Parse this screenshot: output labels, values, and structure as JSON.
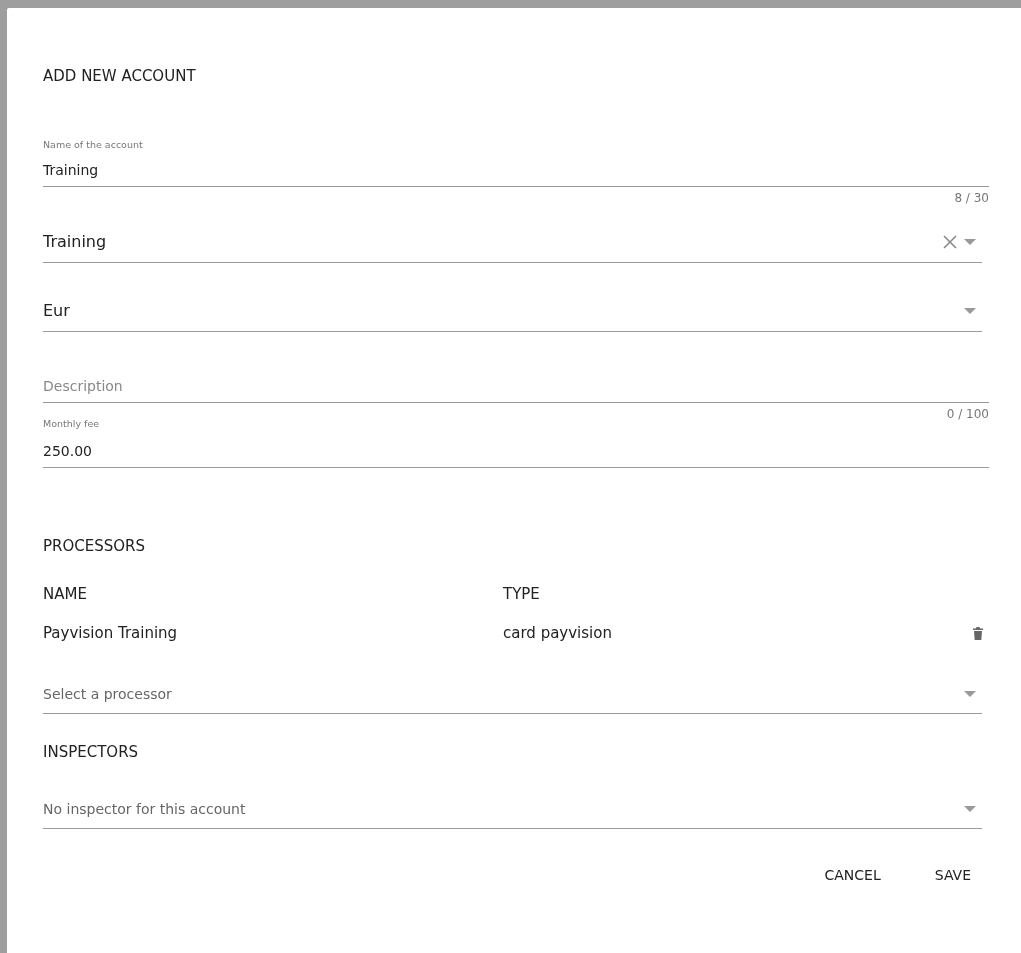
{
  "dialog": {
    "title": "ADD NEW ACCOUNT"
  },
  "fields": [
    {
      "kind": "text",
      "label": "Name of the account",
      "value": "Training",
      "counter": "8 / 30"
    },
    {
      "kind": "select",
      "value": "Training",
      "clearable": true
    },
    {
      "kind": "select",
      "value": "Eur",
      "clearable": false
    },
    {
      "kind": "text",
      "placeholder": "Description",
      "counter": "0 / 100"
    },
    {
      "kind": "text",
      "label": "Monthly fee",
      "value": "250.00"
    }
  ],
  "processors": {
    "heading": "PROCESSORS",
    "columns": [
      "NAME",
      "TYPE"
    ],
    "rows": [
      {
        "name": "Payvision Training",
        "type": "card payvision"
      }
    ],
    "select": {
      "placeholder": "Select a processor"
    }
  },
  "inspectors": {
    "heading": "INSPECTORS",
    "select": {
      "placeholder": "No inspector for this account"
    }
  },
  "buttons": [
    "CANCEL",
    "SAVE"
  ]
}
